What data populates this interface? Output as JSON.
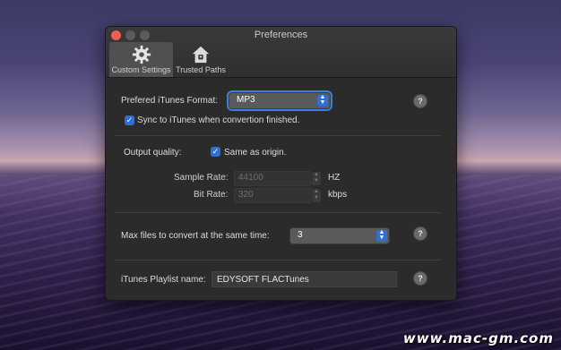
{
  "window": {
    "title": "Preferences",
    "tabs": [
      {
        "label": "Custom Settings",
        "icon": "gear-icon",
        "active": true
      },
      {
        "label": "Trusted Paths",
        "icon": "house-lock-icon",
        "active": false
      }
    ]
  },
  "format": {
    "label": "Prefered iTunes Format:",
    "value": "MP3",
    "sync_label": "Sync to iTunes when convertion finished.",
    "sync_checked": true
  },
  "quality": {
    "label": "Output quality:",
    "same_as_origin_label": "Same as origin.",
    "same_as_origin_checked": true,
    "sample_rate_label": "Sample Rate:",
    "sample_rate_value": "44100",
    "sample_rate_unit": "HZ",
    "bit_rate_label": "Bit Rate:",
    "bit_rate_value": "320",
    "bit_rate_unit": "kbps"
  },
  "max_files": {
    "label": "Max files to convert at the same time:",
    "value": "3"
  },
  "playlist": {
    "label": "iTunes Playlist name:",
    "value": "EDYSOFT FLACTunes"
  },
  "help_symbol": "?",
  "watermark": "www.mac-gm.com",
  "colors": {
    "accent": "#2f6fd6",
    "window_bg": "#2b2b2b",
    "close_button": "#ec5f56"
  }
}
